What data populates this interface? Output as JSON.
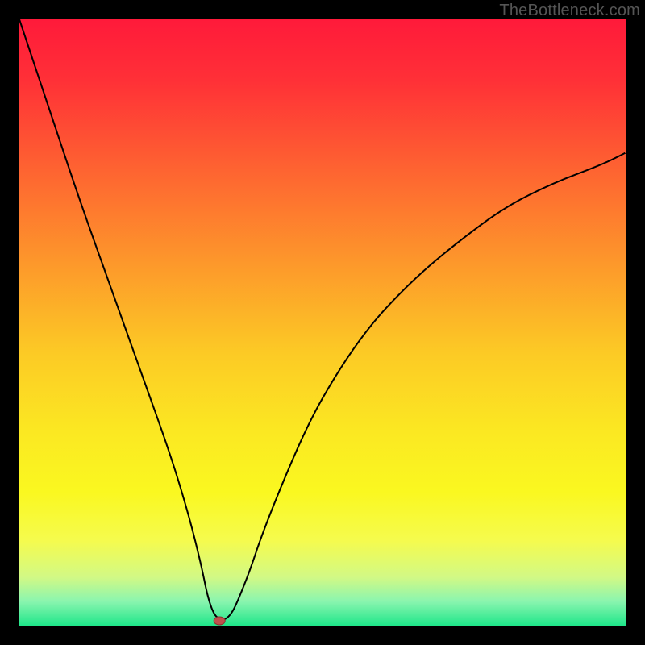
{
  "watermark": "TheBottleneck.com",
  "gradient_stops": [
    {
      "offset": 0.0,
      "color": "#ff1a3a"
    },
    {
      "offset": 0.1,
      "color": "#ff3037"
    },
    {
      "offset": 0.25,
      "color": "#fe6431"
    },
    {
      "offset": 0.4,
      "color": "#fd972b"
    },
    {
      "offset": 0.55,
      "color": "#fcca25"
    },
    {
      "offset": 0.68,
      "color": "#fbe822"
    },
    {
      "offset": 0.78,
      "color": "#faf820"
    },
    {
      "offset": 0.86,
      "color": "#f5fb4e"
    },
    {
      "offset": 0.92,
      "color": "#d2f985"
    },
    {
      "offset": 0.96,
      "color": "#8af5af"
    },
    {
      "offset": 1.0,
      "color": "#1fe68a"
    }
  ],
  "chart_data": {
    "type": "line",
    "title": "",
    "xlabel": "",
    "ylabel": "",
    "xlim": [
      0,
      100
    ],
    "ylim": [
      0,
      100
    ],
    "grid": false,
    "series": [
      {
        "name": "bottleneck-curve",
        "x": [
          0,
          5,
          10,
          15,
          20,
          25,
          28,
          30,
          31,
          32,
          33,
          34,
          35,
          36,
          38,
          40,
          44,
          48,
          52,
          56,
          60,
          66,
          72,
          80,
          88,
          96,
          100
        ],
        "y": [
          100,
          85,
          70,
          56,
          42,
          28,
          18,
          10,
          5,
          2,
          1,
          1,
          2,
          4,
          9,
          15,
          25,
          34,
          41,
          47,
          52,
          58,
          63,
          69,
          73,
          76,
          78
        ]
      }
    ],
    "marker": {
      "name": "optimal-point",
      "x": 33,
      "y": 0.8,
      "color": "#c0504d"
    }
  }
}
